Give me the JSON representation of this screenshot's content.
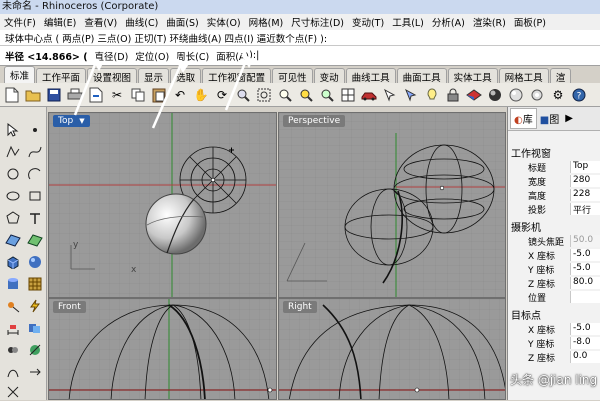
{
  "window": {
    "title": "未命名 - Rhinoceros (Corporate)"
  },
  "menu": [
    "文件(F)",
    "编辑(E)",
    "查看(V)",
    "曲线(C)",
    "曲面(S)",
    "实体(O)",
    "网格(M)",
    "尺寸标注(D)",
    "变动(T)",
    "工具(L)",
    "分析(A)",
    "渲染(R)",
    "面板(P)"
  ],
  "command": {
    "history": "球体中心点 ( 两点(P)  三点(O)  正切(T)  环绕曲线(A)  四点(I)  逼近数个点(F) ):",
    "prompt": "半径 <14.866> (",
    "options": [
      "直径(D)",
      "定位(O)",
      "周长(C)",
      "面积(A)"
    ],
    "tail": "):"
  },
  "tabs": [
    "标准",
    "工作平面",
    "设置视图",
    "显示",
    "选取",
    "工作视窗配置",
    "可见性",
    "变动",
    "曲线工具",
    "曲面工具",
    "实体工具",
    "网格工具",
    "渲"
  ],
  "viewports": {
    "top": "Top",
    "perspective": "Perspective",
    "front": "Front",
    "right": "Right"
  },
  "axes": {
    "x": "x",
    "y": "y"
  },
  "panel": {
    "tabs": [
      "库",
      "图",
      "▶"
    ],
    "section_viewport": "工作视窗",
    "rows1": [
      {
        "k": "标题",
        "v": "Top"
      },
      {
        "k": "宽度",
        "v": "280"
      },
      {
        "k": "高度",
        "v": "228"
      },
      {
        "k": "投影",
        "v": "平行"
      }
    ],
    "section_camera": "摄影机",
    "rows2": [
      {
        "k": "镜头焦距",
        "v": "50.0"
      },
      {
        "k": "X 座标",
        "v": "-5.0"
      },
      {
        "k": "Y 座标",
        "v": "-5.0"
      },
      {
        "k": "Z 座标",
        "v": "80.0"
      },
      {
        "k": "位置",
        "v": ""
      }
    ],
    "section_target": "目标点",
    "rows3": [
      {
        "k": "X 座标",
        "v": "-5.0"
      },
      {
        "k": "Y 座标",
        "v": "-8.0"
      },
      {
        "k": "Z 座标",
        "v": "0.0"
      }
    ]
  },
  "watermark": "头条 @jian ling",
  "colors": {
    "viewport_bg": "#9a9a9a",
    "active_viewport_label": "#2a5ea8",
    "annotation_arrow": "#ffffff"
  }
}
